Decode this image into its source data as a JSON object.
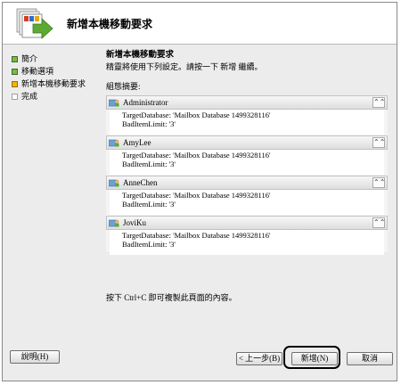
{
  "wizard": {
    "title": "新增本機移動要求"
  },
  "nav": {
    "items": [
      {
        "label": "簡介",
        "state": "done"
      },
      {
        "label": "移動選項",
        "state": "done"
      },
      {
        "label": "新增本機移動要求",
        "state": "current"
      },
      {
        "label": "完成",
        "state": "pending"
      }
    ]
  },
  "main": {
    "section_title": "新增本機移動要求",
    "instruction": "精靈將使用下列設定。請按一下 新增 繼續。",
    "summary_label": "組態摘要:",
    "users": [
      {
        "name": "Administrator",
        "line1": "TargetDatabase: 'Mailbox Database 1499328116'",
        "line2": "BadItemLimit: '3'"
      },
      {
        "name": "AmyLee",
        "line1": "TargetDatabase: 'Mailbox Database 1499328116'",
        "line2": "BadItemLimit: '3'"
      },
      {
        "name": "AnneChen",
        "line1": "TargetDatabase: 'Mailbox Database 1499328116'",
        "line2": "BadItemLimit: '3'"
      },
      {
        "name": "JoviKu",
        "line1": "TargetDatabase: 'Mailbox Database 1499328116'",
        "line2": "BadItemLimit: '3'"
      }
    ],
    "copy_note": "按下 Ctrl+C 即可複製此頁面的內容。"
  },
  "footer": {
    "help_label": "說明(H)",
    "back_label": "< 上一步(B)",
    "new_label": "新增(N)",
    "cancel_label": "取消"
  },
  "icons": {
    "collapse": "double-chevron-up-icon",
    "user": "user-mailbox-icon",
    "wizard": "mailbox-move-icon"
  },
  "colors": {
    "done_bullet": "#7dba3c",
    "current_bullet": "#f2b400",
    "wizard_arrow": "#5ea932"
  }
}
